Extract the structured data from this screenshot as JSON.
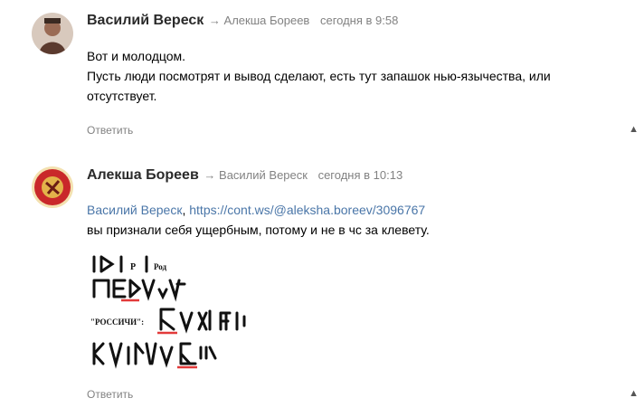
{
  "comments": [
    {
      "author": "Василий Вереск",
      "reply_to": "→ Алекша Бореев",
      "time": "сегодня в 9:58",
      "lines": [
        "Вот и молодцом.",
        "Пусть люди посмотрят и вывод сделают, есть тут запашок нью-язычества, или",
        "отсутствует."
      ],
      "reply_label": "Ответить",
      "up_icon": "arrow-up-icon"
    },
    {
      "author": "Алекша Бореев",
      "reply_to": "→ Василий Вереск",
      "time": "сегодня в 10:13",
      "mention": "Василий Вереск",
      "mention_sep": ", ",
      "link": "https://cont.ws/@aleksha.boreev/3096767",
      "line2": "вы признали себя ущербным, потому и не в чс за клевету.",
      "image_labels": [
        "P",
        "Род",
        "\"РОССИЧИ\":"
      ],
      "reply_label": "Ответить",
      "up_icon": "arrow-up-icon"
    }
  ],
  "colors": {
    "link": "#4a76a8",
    "meta": "#828282",
    "underline": "#e23a3a"
  }
}
